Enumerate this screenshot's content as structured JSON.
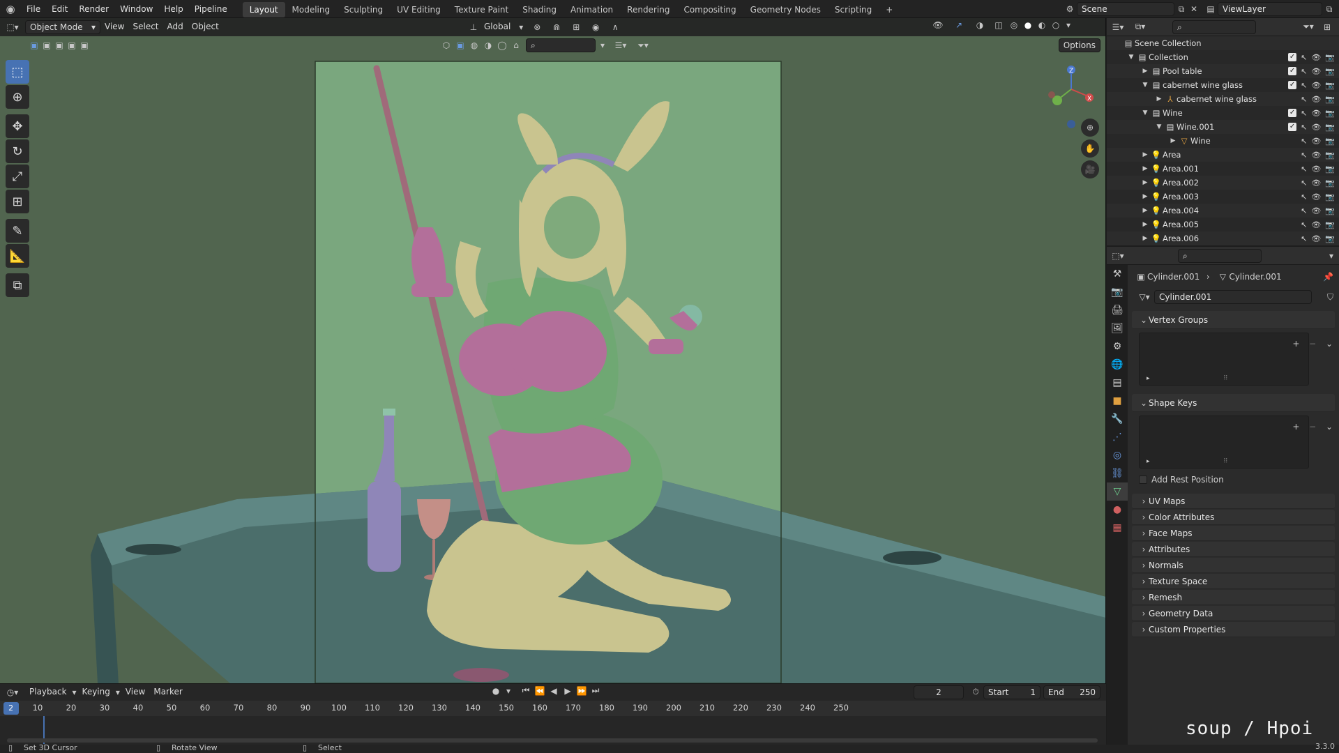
{
  "topbar": {
    "menus": [
      "File",
      "Edit",
      "Render",
      "Window",
      "Help",
      "Pipeline"
    ],
    "workspaces": [
      "Layout",
      "Modeling",
      "Sculpting",
      "UV Editing",
      "Texture Paint",
      "Shading",
      "Animation",
      "Rendering",
      "Compositing",
      "Geometry Nodes",
      "Scripting"
    ],
    "active_workspace": "Layout",
    "add_tab": "+",
    "scene": "Scene",
    "view_layer": "ViewLayer"
  },
  "viewport_header": {
    "mode": "Object Mode",
    "menus": [
      "View",
      "Select",
      "Add",
      "Object"
    ],
    "orientation": "Global",
    "options": "Options"
  },
  "tools": [
    "select-box",
    "cursor",
    "move",
    "rotate",
    "scale",
    "transform",
    "annotate",
    "measure",
    "add-cube"
  ],
  "outliner": {
    "rows": [
      {
        "label": "Scene Collection",
        "depth": 0,
        "type": "scene"
      },
      {
        "label": "Collection",
        "depth": 1,
        "type": "collection",
        "checked": true
      },
      {
        "label": "Pool table",
        "depth": 2,
        "type": "collection",
        "checked": true
      },
      {
        "label": "cabernet wine glass",
        "depth": 2,
        "type": "collection",
        "checked": true
      },
      {
        "label": "cabernet wine glass",
        "depth": 3,
        "type": "object"
      },
      {
        "label": "Wine",
        "depth": 2,
        "type": "collection",
        "checked": true
      },
      {
        "label": "Wine.001",
        "depth": 3,
        "type": "collection",
        "checked": true
      },
      {
        "label": "Wine",
        "depth": 4,
        "type": "mesh"
      },
      {
        "label": "Area",
        "depth": 2,
        "type": "light"
      },
      {
        "label": "Area.001",
        "depth": 2,
        "type": "light"
      },
      {
        "label": "Area.002",
        "depth": 2,
        "type": "light"
      },
      {
        "label": "Area.003",
        "depth": 2,
        "type": "light"
      },
      {
        "label": "Area.004",
        "depth": 2,
        "type": "light"
      },
      {
        "label": "Area.005",
        "depth": 2,
        "type": "light"
      },
      {
        "label": "Area.006",
        "depth": 2,
        "type": "light"
      }
    ]
  },
  "properties": {
    "breadcrumb_object": "Cylinder.001",
    "breadcrumb_data": "Cylinder.001",
    "data_name": "Cylinder.001",
    "vertex_groups": "Vertex Groups",
    "shape_keys": "Shape Keys",
    "add_rest_position": "Add Rest Position",
    "panels": [
      "UV Maps",
      "Color Attributes",
      "Face Maps",
      "Attributes",
      "Normals",
      "Texture Space",
      "Remesh",
      "Geometry Data",
      "Custom Properties"
    ]
  },
  "timeline": {
    "menus": [
      "Playback",
      "Keying",
      "View",
      "Marker"
    ],
    "current_frame": "2",
    "start_label": "Start",
    "start": "1",
    "end_label": "End",
    "end": "250",
    "ticks": [
      "10",
      "20",
      "30",
      "40",
      "50",
      "60",
      "70",
      "80",
      "90",
      "100",
      "110",
      "120",
      "130",
      "140",
      "150",
      "160",
      "170",
      "180",
      "190",
      "200",
      "210",
      "220",
      "230",
      "240",
      "250"
    ]
  },
  "statusbar": {
    "left": "Set 3D Cursor",
    "middle": "Rotate View",
    "right": "Select",
    "version": "3.3.0"
  },
  "watermark": "soup / Hpoi",
  "colors": {
    "accent": "#4772b3",
    "viewport_bg": "#51654f",
    "camera_frame": "#7aa77e",
    "figure_skin": "#c9c48f",
    "outfit_pink": "#b36f9a",
    "outfit_green": "#6fa873",
    "table": "#3f5d5b"
  }
}
